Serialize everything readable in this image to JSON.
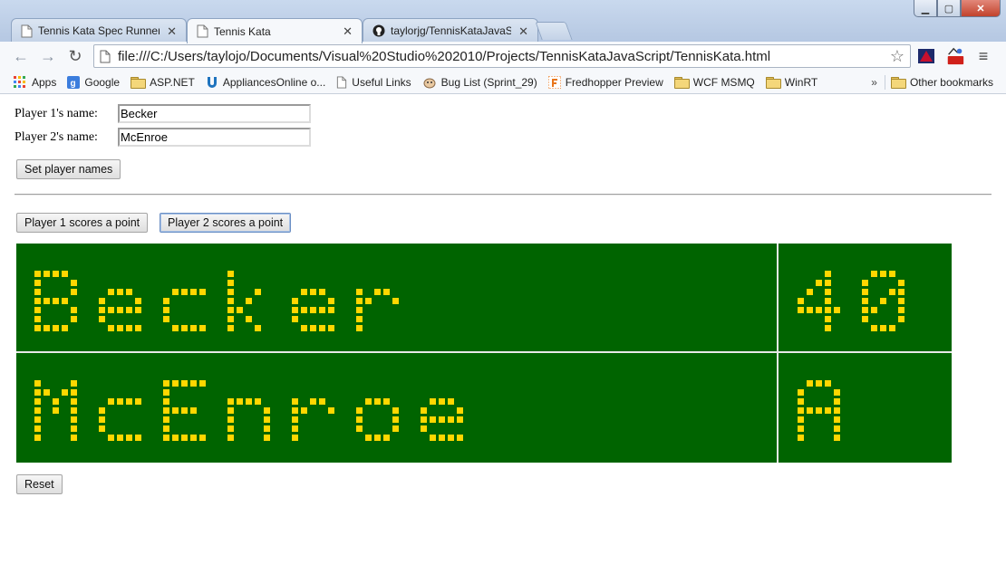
{
  "browser": {
    "tabs": [
      {
        "title": "Tennis Kata Spec Runner",
        "active": false,
        "icon": "page-icon"
      },
      {
        "title": "Tennis Kata",
        "active": true,
        "icon": "page-icon"
      },
      {
        "title": "taylorjg/TennisKataJavaSc",
        "active": false,
        "icon": "github-icon"
      }
    ],
    "address": "file:///C:/Users/taylojo/Documents/Visual%20Studio%202010/Projects/TennisKataJavaScript/TennisKata.html",
    "bookmarks": [
      {
        "label": "Apps",
        "icon": "apps-grid-icon"
      },
      {
        "label": "Google",
        "icon": "google-icon"
      },
      {
        "label": "ASP.NET",
        "icon": "folder-icon"
      },
      {
        "label": "AppliancesOnline o...",
        "icon": "u-logo-icon"
      },
      {
        "label": "Useful Links",
        "icon": "page-icon"
      },
      {
        "label": "Bug List (Sprint_29)",
        "icon": "bug-icon"
      },
      {
        "label": "Fredhopper Preview",
        "icon": "f-logo-icon"
      },
      {
        "label": "WCF MSMQ",
        "icon": "folder-icon"
      },
      {
        "label": "WinRT",
        "icon": "folder-icon"
      }
    ],
    "overflow": "»",
    "other_bookmarks": "Other bookmarks"
  },
  "form": {
    "player1_label": "Player 1's name:",
    "player1_value": "Becker",
    "player2_label": "Player 2's name:",
    "player2_value": "McEnroe",
    "set_names_button": "Set player names"
  },
  "controls": {
    "p1_scores": "Player 1 scores a point",
    "p2_scores": "Player 2 scores a point",
    "reset": "Reset"
  },
  "scoreboard": {
    "rows": [
      {
        "name": "Becker",
        "score": "40"
      },
      {
        "name": "McEnroe",
        "score": "A"
      }
    ],
    "colors": {
      "background": "#006400",
      "led": "#ffd700",
      "divider": "#e8e8e8"
    }
  }
}
